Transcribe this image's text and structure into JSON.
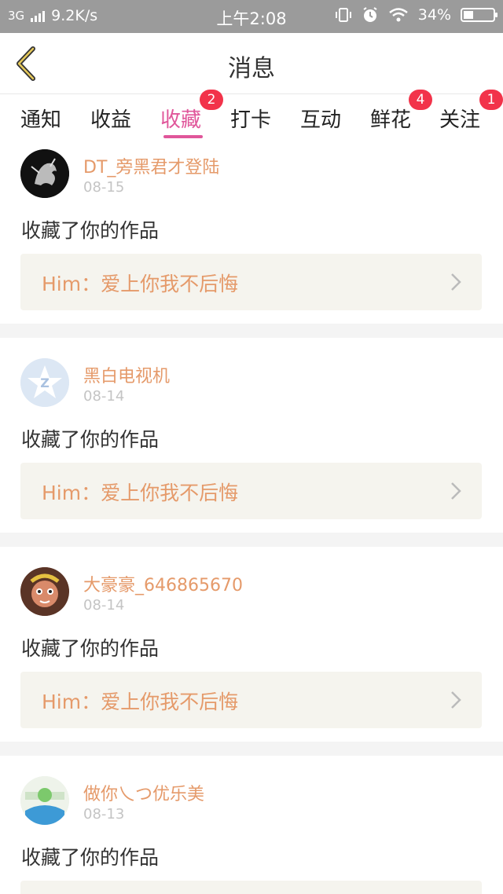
{
  "status_bar": {
    "network": "3G",
    "speed": "9.2K/s",
    "time": "上午2:08",
    "battery": "34%",
    "battery_level": 0.34
  },
  "nav": {
    "title": "消息",
    "back_icon": "chevron-left-icon"
  },
  "tabs": [
    {
      "label": "通知"
    },
    {
      "label": "收益"
    },
    {
      "label": "收藏",
      "badge": "2",
      "active": true
    },
    {
      "label": "打卡"
    },
    {
      "label": "互动"
    },
    {
      "label": "鲜花",
      "badge": "4"
    },
    {
      "label": "关注",
      "badge": "1"
    }
  ],
  "messages": [
    {
      "username": "DT_旁黑君才登陆",
      "date": "08-15",
      "action": "收藏了你的作品",
      "work": "Him：爱上你我不后悔"
    },
    {
      "username": "黑白电视机",
      "date": "08-14",
      "action": "收藏了你的作品",
      "work": "Him：爱上你我不后悔"
    },
    {
      "username": "大豪豪_646865670",
      "date": "08-14",
      "action": "收藏了你的作品",
      "work": "Him：爱上你我不后悔"
    },
    {
      "username": "做你乀つ优乐美",
      "date": "08-13",
      "action": "收藏了你的作品",
      "work": ""
    }
  ],
  "colors": {
    "accent": "#e0569a",
    "username": "#e59a6a",
    "badge": "#f2334a",
    "status_bar": "#9b9b9b"
  }
}
